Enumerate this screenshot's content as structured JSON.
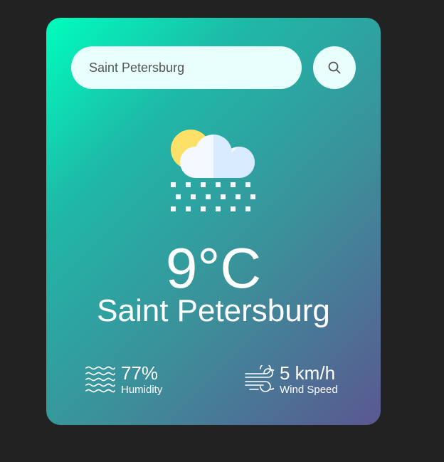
{
  "search": {
    "value": "Saint Petersburg",
    "button_icon": "search-icon"
  },
  "weather": {
    "icon": "partly-cloudy-snow-icon",
    "temperature": "9°C",
    "city": "Saint Petersburg"
  },
  "details": {
    "humidity": {
      "icon": "humidity-waves-icon",
      "value": "77%",
      "label": "Humidity"
    },
    "wind": {
      "icon": "wind-icon",
      "value": "5 km/h",
      "label": "Wind Speed"
    }
  },
  "colors": {
    "background": "#222222",
    "gradient_start": "#00fdbd",
    "gradient_end": "#5b5790",
    "input_bg": "#e9fffb"
  }
}
